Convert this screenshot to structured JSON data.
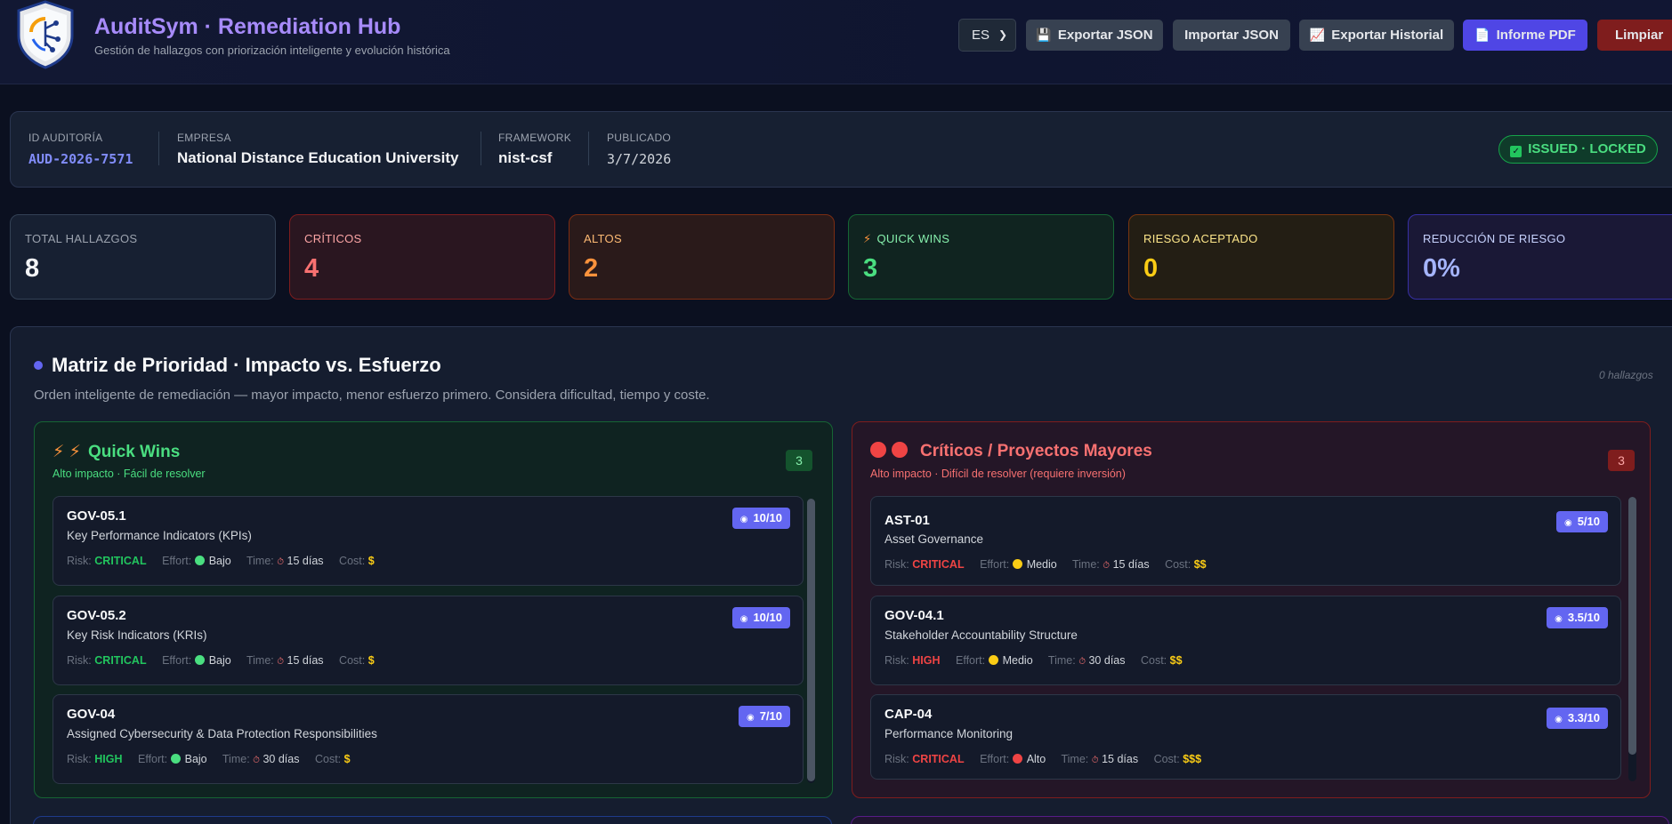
{
  "header": {
    "title": "AuditSym · Remediation Hub",
    "subtitle": "Gestión de hallazgos con priorización inteligente y evolución histórica",
    "language": "ES",
    "buttons": {
      "export_json": "Exportar JSON",
      "import_json": "Importar JSON",
      "export_history": "Exportar Historial",
      "pdf_report": "Informe PDF",
      "clear": "Limpiar"
    }
  },
  "audit": {
    "id_label": "ID AUDITORÍA",
    "id_value": "AUD-2026-7571",
    "company_label": "EMPRESA",
    "company_value": "National Distance Education University",
    "framework_label": "FRAMEWORK",
    "framework_value": "nist-csf",
    "published_label": "PUBLICADO",
    "published_value": "3/7/2026",
    "status": "ISSUED · LOCKED"
  },
  "kpis": [
    {
      "label": "TOTAL HALLAZGOS",
      "value": "8",
      "color": "#f3f4f6"
    },
    {
      "label": "CRÍTICOS",
      "value": "4",
      "color": "#f87171"
    },
    {
      "label": "ALTOS",
      "value": "2",
      "color": "#fb923c"
    },
    {
      "label": "QUICK WINS",
      "value": "3",
      "color": "#4ade80"
    },
    {
      "label": "RIESGO ACEPTADO",
      "value": "0",
      "color": "#facc15"
    },
    {
      "label": "REDUCCIÓN DE RIESGO",
      "value": "0%",
      "color": "#a5b4fc"
    }
  ],
  "matrix": {
    "title": "Matriz de Prioridad · Impacto vs. Esfuerzo",
    "subtitle": "Orden inteligente de remediación — mayor impacto, menor esfuerzo primero. Considera dificultad, tiempo y coste.",
    "count": "0 hallazgos",
    "labels": {
      "risk": "Risk:",
      "effort": "Effort:",
      "time": "Time:",
      "cost": "Cost:"
    },
    "quick_wins": {
      "title": "Quick Wins",
      "subtitle": "Alto impacto · Fácil de resolver",
      "count": "3",
      "items": [
        {
          "id": "GOV-05.1",
          "name": "Key Performance Indicators (KPIs)",
          "risk": "CRITICAL",
          "effort": "Bajo",
          "time": "15 días",
          "cost": "$",
          "score": "10/10"
        },
        {
          "id": "GOV-05.2",
          "name": "Key Risk Indicators (KRIs)",
          "risk": "CRITICAL",
          "effort": "Bajo",
          "time": "15 días",
          "cost": "$",
          "score": "10/10"
        },
        {
          "id": "GOV-04",
          "name": "Assigned Cybersecurity & Data Protection Responsibilities",
          "risk": "HIGH",
          "effort": "Bajo",
          "time": "30 días",
          "cost": "$",
          "score": "7/10"
        }
      ]
    },
    "critical": {
      "title": "Críticos / Proyectos Mayores",
      "subtitle": "Alto impacto · Difícil de resolver (requiere inversión)",
      "count": "3",
      "items": [
        {
          "id": "AST-01",
          "name": "Asset Governance",
          "risk": "CRITICAL",
          "effort": "Medio",
          "time": "15 días",
          "cost": "$$",
          "score": "5/10"
        },
        {
          "id": "GOV-04.1",
          "name": "Stakeholder Accountability Structure",
          "risk": "HIGH",
          "effort": "Medio",
          "time": "30 días",
          "cost": "$$",
          "score": "3.5/10"
        },
        {
          "id": "CAP-04",
          "name": "Performance Monitoring",
          "risk": "CRITICAL",
          "effort": "Alto",
          "time": "15 días",
          "cost": "$$$",
          "score": "3.3/10"
        }
      ]
    }
  },
  "colors": {
    "accent": "#6366f1",
    "brand": "#a78bfa",
    "quick_win": "#4ade80",
    "critical": "#ef4444"
  }
}
